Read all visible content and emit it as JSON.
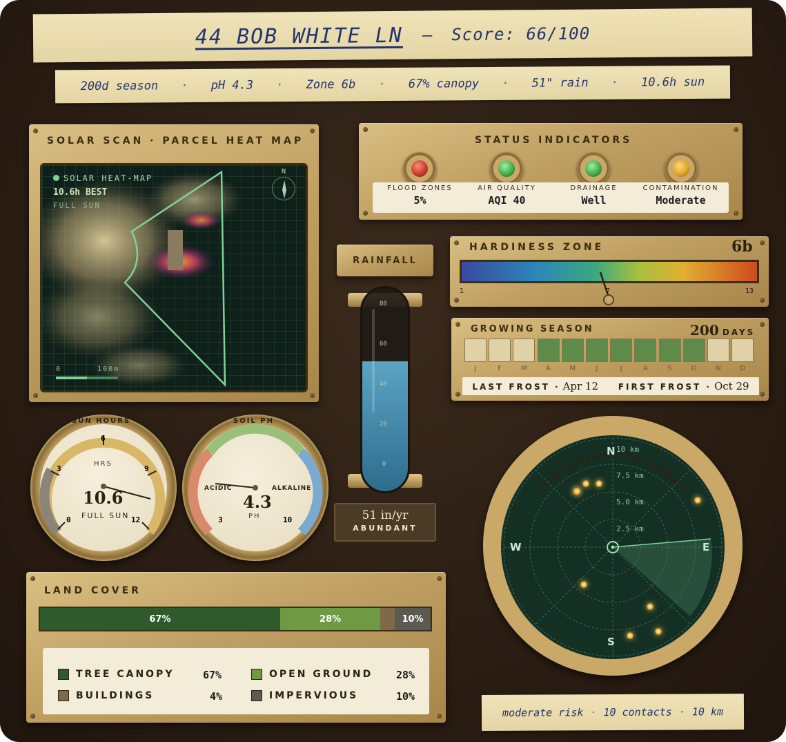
{
  "header": {
    "address": "44 BOB WHITE LN",
    "separator": "–",
    "score": "Score: 66/100"
  },
  "summary": [
    "200d season",
    "pH 4.3",
    "Zone 6b",
    "67% canopy",
    "51\" rain",
    "10.6h sun"
  ],
  "solar": {
    "title": "SOLAR SCAN · PARCEL HEAT MAP",
    "map_label": "SOLAR HEAT-MAP",
    "best": "10.6h BEST",
    "condition": "FULL SUN",
    "north": "N",
    "scale_start": "0",
    "scale_end": "100m"
  },
  "status": {
    "title": "STATUS INDICATORS",
    "items": [
      {
        "label": "FLOOD ZONES",
        "value": "5%",
        "color": "#c0392b"
      },
      {
        "label": "AIR QUALITY",
        "value": "AQI 40",
        "color": "#3fa544"
      },
      {
        "label": "DRAINAGE",
        "value": "Well",
        "color": "#3fa544"
      },
      {
        "label": "CONTAMINATION",
        "value": "Moderate",
        "color": "#e0a020"
      }
    ]
  },
  "rainfall": {
    "title": "RAINFALL",
    "ticks": [
      "80",
      "60",
      "40",
      "20",
      "0"
    ],
    "level_fraction": 0.64,
    "value": "51 in/yr",
    "rating": "ABUNDANT"
  },
  "hardiness": {
    "title": "HARDINESS ZONE",
    "zone": "6b",
    "min": "1",
    "mid": "7",
    "max": "13"
  },
  "season": {
    "title": "GROWING SEASON",
    "days": "200",
    "days_unit": "DAYS",
    "months": [
      "J",
      "F",
      "M",
      "A",
      "M",
      "J",
      "J",
      "A",
      "S",
      "O",
      "N",
      "D"
    ],
    "active": [
      false,
      false,
      false,
      true,
      true,
      true,
      true,
      true,
      true,
      true,
      false,
      false
    ],
    "last_frost_label": "LAST FROST ·",
    "last_frost": "Apr 12",
    "first_frost_label": "FIRST FROST ·",
    "first_frost": "Oct 29"
  },
  "sun_gauge": {
    "title": "SUN HOURS",
    "unit": "HRS",
    "value": "10.6",
    "label": "FULL SUN",
    "ticks": [
      "0",
      "3",
      "6",
      "9",
      "12"
    ]
  },
  "ph_gauge": {
    "title": "SOIL PH",
    "left": "ACIDIC",
    "right": "ALKALINE",
    "value": "4.3",
    "unit": "PH",
    "min": "3",
    "max": "10"
  },
  "radar": {
    "title": "CONTAMINATION RADAR",
    "n": "N",
    "s": "S",
    "e": "E",
    "w": "W",
    "rings": [
      "10 km",
      "7.5 km",
      "5.0 km",
      "2.5 km"
    ]
  },
  "landcover": {
    "title": "LAND COVER",
    "bar": [
      {
        "label": "67%",
        "pct": 67,
        "color": "#2f5a2c"
      },
      {
        "label": "28%",
        "pct": 28,
        "color": "#6e9a44"
      },
      {
        "label": "",
        "pct": 4,
        "color": "#7c6a4a"
      },
      {
        "label": "10%",
        "pct": 10,
        "color": "#5a5a52"
      }
    ],
    "legend": [
      {
        "name": "TREE CANOPY",
        "value": "67%",
        "color": "#2f5a2c"
      },
      {
        "name": "OPEN GROUND",
        "value": "28%",
        "color": "#6e9a44"
      },
      {
        "name": "BUILDINGS",
        "value": "4%",
        "color": "#7c6a4a"
      },
      {
        "name": "IMPERVIOUS",
        "value": "10%",
        "color": "#5a5a52"
      }
    ]
  },
  "footer": {
    "risk": "moderate risk",
    "contacts": "10 contacts",
    "radius": "10 km"
  }
}
